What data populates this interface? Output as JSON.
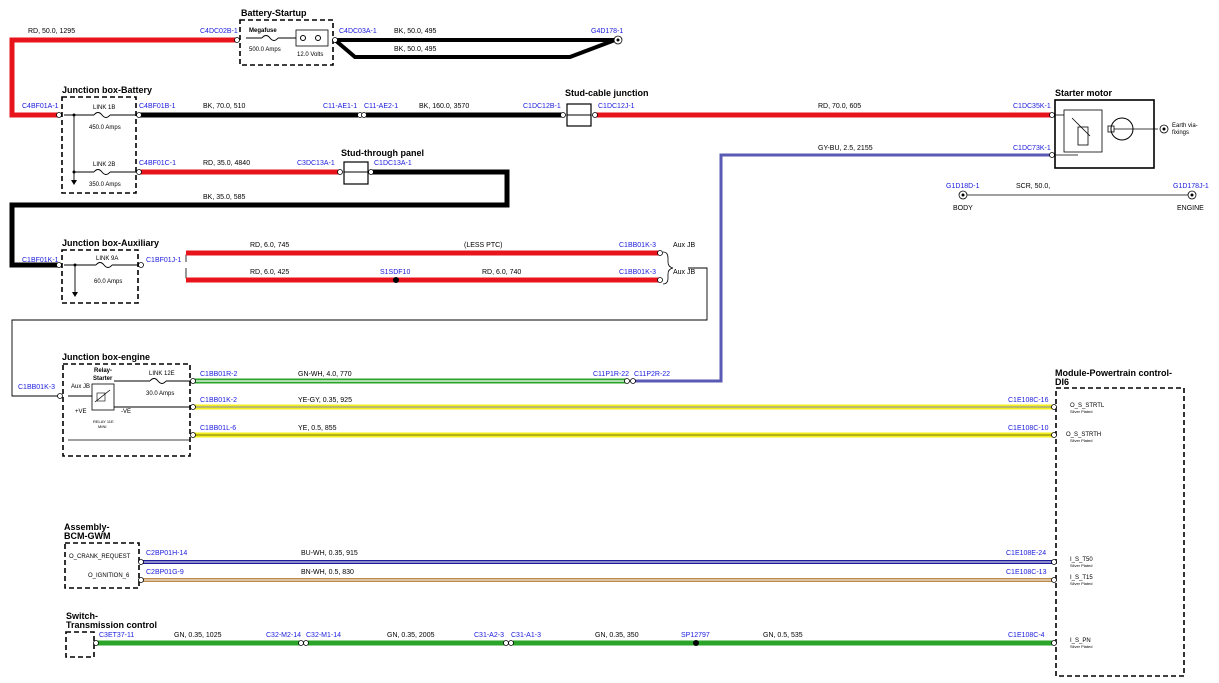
{
  "components": {
    "battery_startup": {
      "title": "Battery-Startup",
      "fuse_label": "Megafuse",
      "fuse_rating": "500.0 Amps",
      "voltage": "12.0 Volts"
    },
    "junction_box_battery": {
      "title": "Junction box-Battery",
      "link1_name": "LINK 1B",
      "link1_rating": "450.0 Amps",
      "link2_name": "LINK 2B",
      "link2_rating": "350.0 Amps"
    },
    "stud_cable_junction": {
      "title": "Stud-cable junction"
    },
    "stud_through_panel": {
      "title": "Stud-through panel"
    },
    "starter_motor": {
      "title": "Starter motor",
      "earth_label_1": "Earth via-",
      "earth_label_2": "fixings"
    },
    "junction_box_auxiliary": {
      "title": "Junction box-Auxiliary",
      "link_name": "LINK 9A",
      "link_rating": "60.0 Amps"
    },
    "junction_box_engine": {
      "title": "Junction box-engine",
      "relay_1": "Relay-",
      "relay_2": "Starter",
      "link_name": "LINK 12E",
      "link_rating": "30.0 Amps",
      "aux_jb": "Aux JB",
      "plus_ve": "+VE",
      "minus_ve": "-VE",
      "relay_small_1": "RELAY 11E",
      "relay_small_2": "MINI"
    },
    "module_powertrain": {
      "title_1": "Module-Powertrain control-",
      "title_2": "DI6"
    },
    "assembly_bcm": {
      "title_1": "Assembly-",
      "title_2": "BCM-GWM",
      "pin_1": "O_CRANK_REQUEST",
      "pin_2": "O_IGNITION_6"
    },
    "switch_transmission": {
      "title_1": "Switch-",
      "title_2": "Transmission control"
    }
  },
  "grounds": {
    "body": "BODY",
    "engine": "ENGINE",
    "body_conn": "G1D18D-1",
    "engine_conn": "G1D178J-1",
    "wire_label": "SCR, 50.0,"
  },
  "connectors": {
    "c4dc02b": "C4DC02B-1",
    "c4dc03a": "C4DC03A-1",
    "g4d178": "G4D178-1",
    "c4bf01a": "C4BF01A-1",
    "c4bf01b": "C4BF01B-1",
    "c11ae1": "C11-AE1-1",
    "c11ae2": "C11-AE2-1",
    "c1dc12b": "C1DC12B-1",
    "c1dc12j": "C1DC12J-1",
    "c1dc35k": "C1DC35K-1",
    "c1dc73k": "C1DC73K-1",
    "c4bf01c": "C4BF01C-1",
    "c3dc13a": "C3DC13A-1",
    "c1dc13a": "C1DC13A-1",
    "c1bf01k": "C1BF01K-1",
    "c1bf01j": "C1BF01J-1",
    "c1bb01k3a": "C1BB01K-3",
    "c1bb01k3b": "C1BB01K-3",
    "s1sdf10": "S1SDF10",
    "aux_jb_a": "Aux JB",
    "aux_jb_b": "Aux JB",
    "c1bb01k3c": "C1BB01K-3",
    "c1bb01r": "C1BB01R-2",
    "c11p1r": "C11P1R-22",
    "c11p2r": "C11P2R-22",
    "c1bb01k2": "C1BB01K-2",
    "c1e108c16": "C1E108C-16",
    "c1bb01l": "C1BB01L-6",
    "c1e108c10": "C1E108C-10",
    "c2bp01h": "C2BP01H-14",
    "c1e108e24": "C1E108E-24",
    "c2bp01g": "C2BP01G-9",
    "c1e108c13": "C1E108C-13",
    "c3et37": "C3ET37-11",
    "c32m214": "C32-M2-14",
    "c32m114": "C32-M1-14",
    "c31a23": "C31-A2-3",
    "c31a13": "C31-A1-3",
    "sp12797": "SP12797",
    "c1e108c4": "C1E108C-4"
  },
  "pins": {
    "o_s_strtl": "O_S_STRTL",
    "o_s_strth": "O_S_STRTH",
    "i_s_t50": "I_S_T50",
    "i_s_t15": "I_S_T15",
    "i_s_pn": "I_S_PN",
    "silver": "Silver Plated"
  },
  "wires": {
    "w_rd50": "RD, 50.0, 1295",
    "w_bk50a": "BK, 50.0, 495",
    "w_bk50b": "BK, 50.0, 495",
    "w_bk70": "BK, 70.0, 510",
    "w_bk160": "BK, 160.0, 3570",
    "w_rd70": "RD, 70.0, 605",
    "w_gybu": "GY-BU, 2.5, 2155",
    "w_rd35": "RD, 35.0, 4840",
    "w_bk35": "BK, 35.0, 585",
    "w_rd6a": "RD, 6.0, 745",
    "w_lessptc": "(LESS PTC)",
    "w_rd6b": "RD, 6.0, 425",
    "w_rd6c": "RD, 6.0, 740",
    "w_gnwh": "GN-WH, 4.0, 770",
    "w_yegy": "YE-GY, 0.35, 925",
    "w_ye": "YE, 0.5, 855",
    "w_buwh": "BU-WH, 0.35, 915",
    "w_bnwh": "BN-WH, 0.5, 830",
    "w_gn1": "GN, 0.35, 1025",
    "w_gn2": "GN, 0.35, 2005",
    "w_gn3": "GN, 0.35, 350",
    "w_gn4": "GN, 0.5, 535"
  },
  "colors": {
    "red": "#e8141b",
    "black": "#000000",
    "blue_violet": "#5a5ab4",
    "green": "#2aa52a",
    "yellow": "#f2ee1e",
    "dark_blue": "#1a1a9a",
    "brown_white": "#b98a4a",
    "connector_text": "#1a1adc"
  }
}
